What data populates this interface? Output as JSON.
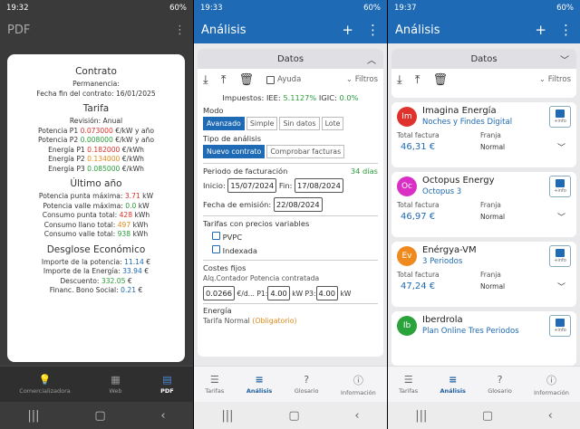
{
  "screen1": {
    "status": {
      "time": "19:32",
      "battery": "60%"
    },
    "title": "PDF",
    "dialog": {
      "contrato_h": "Contrato",
      "permanencia": "Permanencia:",
      "fin": "Fecha fin del contrato: 16/01/2025",
      "tarifa_h": "Tarifa",
      "revision": "Revisión: Anual",
      "pp1_l": "Potencia P1 ",
      "pp1_v": "0.073000",
      "pp1_u": " €/kW y año",
      "pp2_l": "Potencia P2 ",
      "pp2_v": "0.008000",
      "pp2_u": " €/kW y año",
      "ep1_l": "Energía P1 ",
      "ep1_v": "0.182000",
      "ep1_u": " €/kWh",
      "ep2_l": "Energía P2 ",
      "ep2_v": "0.134000",
      "ep2_u": " €/kWh",
      "ep3_l": "Energía P3 ",
      "ep3_v": "0.085000",
      "ep3_u": " €/kWh",
      "ultimo_h": "Último año",
      "u1_l": "Potencia punta máxima: ",
      "u1_v": "3.71",
      "u1_u": " kW",
      "u2_l": "Potencia valle máxima: ",
      "u2_v": "0.0",
      "u2_u": " kW",
      "u3_l": "Consumo punta total: ",
      "u3_v": "428",
      "u3_u": " kWh",
      "u4_l": "Consumo llano total: ",
      "u4_v": "497",
      "u4_u": " kWh",
      "u5_l": "Consumo valle total: ",
      "u5_v": "938",
      "u5_u": " kWh",
      "desg_h": "Desglose Económico",
      "d1_l": "Importe de la potencia: ",
      "d1_v": "11.14",
      "d1_u": " €",
      "d2_l": "Importe de la Energía: ",
      "d2_v": "33.94",
      "d2_u": " €",
      "d3_l": "Descuento: ",
      "d3_v": "332.05",
      "d3_u": " €",
      "d4_l": "Financ. Bono Social: ",
      "d4_v": "0.21",
      "d4_u": " €"
    },
    "tabs": [
      "Comercializadora",
      "Web",
      "PDF"
    ]
  },
  "screen2": {
    "status": {
      "time": "19:33",
      "battery": "60%"
    },
    "title": "Análisis",
    "panel_title": "Datos",
    "ayuda": "Ayuda",
    "filtros": "Filtros",
    "impuestos": "Impuestos:",
    "iee_l": "IEE: ",
    "iee_v": "5.1127%",
    "igic_l": "IGIC: ",
    "igic_v": "0.0%",
    "modo": "Modo",
    "modos": [
      "Avanzado",
      "Simple",
      "Sin datos",
      "Lote"
    ],
    "tipo": "Tipo de análisis",
    "tipos": [
      "Nuevo contrato",
      "Comprobar facturas"
    ],
    "periodo": "Periodo de facturación",
    "dias": "34 días",
    "inicio_l": "Inicio:",
    "inicio_v": "15/07/2024",
    "fin_l": "Fin:",
    "fin_v": "17/08/2024",
    "emision_l": "Fecha de emisión:",
    "emision_v": "22/08/2024",
    "tarifas_var": "Tarifas con precios variables",
    "pvpc": "PVPC",
    "indexada": "Indexada",
    "costes": "Costes fijos",
    "alq": "Alq.Contador  Potencia contratada",
    "alq_v": "0.0266",
    "alq_u": "€/d...",
    "p1_l": "P1:",
    "p1_v": "4.00",
    "p3_l": "P3:",
    "p3_v": "4.00",
    "kw": "kW",
    "energia": "Energía",
    "tarifa_normal": "Tarifa Normal ",
    "obligatorio": "(Obligatorio)",
    "tabs": [
      "Tarifas",
      "Análisis",
      "Glosario",
      "Información"
    ]
  },
  "screen3": {
    "status": {
      "time": "19:37",
      "battery": "60%"
    },
    "title": "Análisis",
    "panel_title": "Datos",
    "filtros": "Filtros",
    "total_label": "Total factura",
    "franja_label": "Franja",
    "info_label": "+info",
    "cards": [
      {
        "logo": "Im",
        "name": "Imagina Energía",
        "plan": "Noches y Findes Digital",
        "total": "46,31 €",
        "franja": "Normal",
        "color": "#e0322c"
      },
      {
        "logo": "Oc",
        "name": "Octopus Energy",
        "plan": "Octopus 3",
        "total": "46,97 €",
        "franja": "Normal",
        "color": "#d92fc5"
      },
      {
        "logo": "Ev",
        "name": "Enérgya-VM",
        "plan": "3 Periodos",
        "total": "47,24 €",
        "franja": "Normal",
        "color": "#ef8a1f"
      },
      {
        "logo": "Ib",
        "name": "Iberdrola",
        "plan": "Plan Online Tres Periodos",
        "total": "",
        "franja": "",
        "color": "#2aa33c"
      }
    ],
    "tabs": [
      "Tarifas",
      "Análisis",
      "Glosario",
      "Información"
    ]
  }
}
